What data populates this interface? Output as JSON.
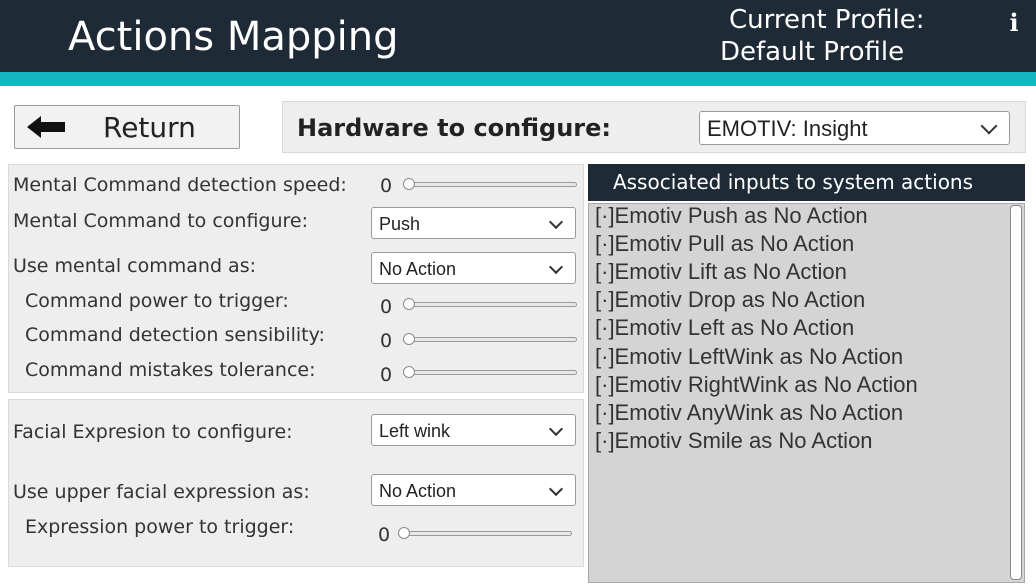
{
  "header": {
    "title": "Actions Mapping",
    "profile_label": "Current Profile:",
    "profile_name": "Default Profile",
    "info_glyph": "i"
  },
  "colors": {
    "header_bg": "#1f2a37",
    "accent": "#13b7bf",
    "panel_bg": "#eeeeee",
    "list_bg": "#d4d4d4"
  },
  "toolbar": {
    "return_label": "Return",
    "return_icon": "arrow-left-icon",
    "hardware_label": "Hardware to configure:",
    "hardware_value": "EMOTIV: Insight"
  },
  "mental": {
    "speed_label": "Mental Command detection speed:",
    "speed_value": 0,
    "command_label": "Mental Command to configure:",
    "command_value": "Push",
    "use_as_label": "Use mental command as:",
    "use_as_value": "No Action",
    "power_label": "Command power to trigger:",
    "power_value": 0,
    "sensibility_label": "Command detection sensibility:",
    "sensibility_value": 0,
    "tolerance_label": "Command mistakes tolerance:",
    "tolerance_value": 0
  },
  "facial": {
    "expression_label": "Facial Expresion to configure:",
    "expression_value": "Left wink",
    "use_as_label": "Use upper facial expression as:",
    "use_as_value": "No Action",
    "power_label": "Expression power to trigger:",
    "power_value": 0
  },
  "associations": {
    "title": "Associated inputs to system actions",
    "items": [
      "[·]Emotiv Push as No Action",
      "[·]Emotiv Pull as No Action",
      "[·]Emotiv Lift as No Action",
      "[·]Emotiv Drop as No Action",
      "[·]Emotiv Left as No Action",
      "[·]Emotiv LeftWink as No Action",
      "[·]Emotiv RightWink as No Action",
      "[·]Emotiv AnyWink as No Action",
      "[·]Emotiv Smile as No Action"
    ]
  }
}
